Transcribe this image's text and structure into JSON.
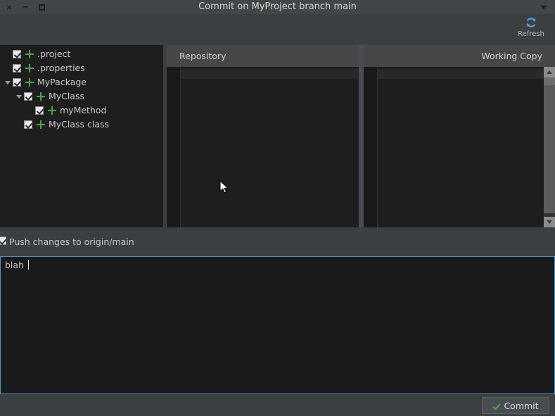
{
  "window": {
    "title": "Commit on MyProject branch main",
    "controls": {
      "close": "×",
      "minimize": "−",
      "maximize": "□",
      "menu": "chevron-down-icon"
    }
  },
  "toolbar": {
    "refresh": {
      "label": "Refresh",
      "icon": "refresh-icon",
      "color": "#4d9fd6"
    }
  },
  "tree": {
    "items": [
      {
        "label": ".project",
        "indent": 0,
        "checked": true,
        "expandable": false,
        "expanded": false,
        "status_icon": "plus-icon"
      },
      {
        "label": ".properties",
        "indent": 0,
        "checked": true,
        "expandable": false,
        "expanded": false,
        "status_icon": "plus-icon"
      },
      {
        "label": "MyPackage",
        "indent": 0,
        "checked": true,
        "expandable": true,
        "expanded": true,
        "status_icon": "plus-icon"
      },
      {
        "label": "MyClass",
        "indent": 1,
        "checked": true,
        "expandable": true,
        "expanded": true,
        "status_icon": "plus-icon"
      },
      {
        "label": "myMethod",
        "indent": 2,
        "checked": true,
        "expandable": false,
        "expanded": false,
        "status_icon": "plus-icon"
      },
      {
        "label": "MyClass class",
        "indent": 1,
        "checked": true,
        "expandable": false,
        "expanded": false,
        "status_icon": "plus-icon"
      }
    ]
  },
  "diff": {
    "left_header": "Repository",
    "right_header": "Working Copy",
    "left_content": "",
    "right_content": "",
    "scrollbar": {
      "up_arrow": "chevron-up-icon",
      "down_arrow": "chevron-down-icon"
    }
  },
  "push": {
    "label": "Push changes to origin/main",
    "checked": true
  },
  "message": {
    "value": "blah",
    "placeholder": "",
    "focused": true,
    "accent_color": "#4d90d0"
  },
  "buttons": {
    "commit": {
      "label": "Commit",
      "icon": "check-icon",
      "icon_color": "#4aa84a"
    }
  },
  "colors": {
    "window_bg": "#3c3f41",
    "panel_bg": "#1e1e1e",
    "titlebar_bg": "#434648",
    "text": "#c7c7c7",
    "accent_blue": "#4d90d0",
    "accent_green": "#3fae3f"
  }
}
